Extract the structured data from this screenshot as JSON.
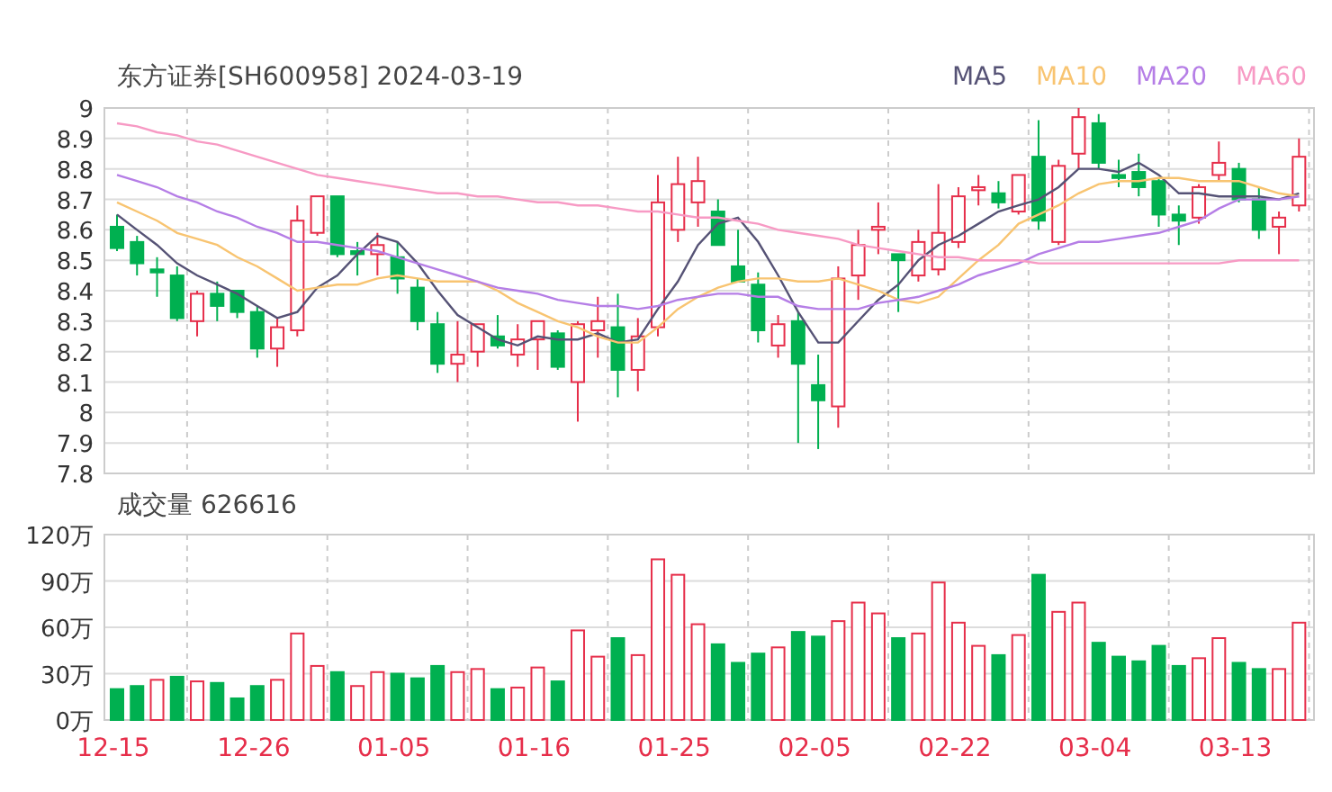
{
  "header": {
    "title": "东方证券[SH600958] 2024-03-19"
  },
  "price_chart": {
    "chart_data": {
      "type": "candlestick",
      "grid": true,
      "ylim": [
        7.8,
        9
      ],
      "yticks": [
        {
          "value": 9,
          "label": "9"
        },
        {
          "value": 8.9,
          "label": "8.9"
        },
        {
          "value": 8.8,
          "label": "8.8"
        },
        {
          "value": 8.7,
          "label": "8.7"
        },
        {
          "value": 8.6,
          "label": "8.6"
        },
        {
          "value": 8.5,
          "label": "8.5"
        },
        {
          "value": 8.4,
          "label": "8.4"
        },
        {
          "value": 8.3,
          "label": "8.3"
        },
        {
          "value": 8.2,
          "label": "8.2"
        },
        {
          "value": 8.1,
          "label": "8.1"
        },
        {
          "value": 8,
          "label": "8"
        },
        {
          "value": 7.9,
          "label": "7.9"
        },
        {
          "value": 7.8,
          "label": "7.8"
        }
      ],
      "ohlc": [
        [
          8.61,
          8.65,
          8.53,
          8.54
        ],
        [
          8.56,
          8.58,
          8.45,
          8.49
        ],
        [
          8.47,
          8.51,
          8.38,
          8.46
        ],
        [
          8.45,
          8.48,
          8.3,
          8.31
        ],
        [
          8.3,
          8.4,
          8.25,
          8.39
        ],
        [
          8.39,
          8.43,
          8.3,
          8.35
        ],
        [
          8.4,
          8.4,
          8.31,
          8.33
        ],
        [
          8.33,
          8.35,
          8.18,
          8.21
        ],
        [
          8.21,
          8.31,
          8.15,
          8.28
        ],
        [
          8.27,
          8.68,
          8.25,
          8.63
        ],
        [
          8.59,
          8.71,
          8.58,
          8.71
        ],
        [
          8.71,
          8.71,
          8.51,
          8.52
        ],
        [
          8.53,
          8.56,
          8.45,
          8.52
        ],
        [
          8.52,
          8.59,
          8.45,
          8.55
        ],
        [
          8.51,
          8.56,
          8.39,
          8.44
        ],
        [
          8.41,
          8.44,
          8.27,
          8.3
        ],
        [
          8.29,
          8.33,
          8.13,
          8.16
        ],
        [
          8.16,
          8.3,
          8.1,
          8.19
        ],
        [
          8.2,
          8.29,
          8.15,
          8.29
        ],
        [
          8.25,
          8.32,
          8.21,
          8.22
        ],
        [
          8.19,
          8.29,
          8.15,
          8.24
        ],
        [
          8.24,
          8.3,
          8.14,
          8.3
        ],
        [
          8.26,
          8.27,
          8.14,
          8.15
        ],
        [
          8.1,
          8.3,
          7.97,
          8.29
        ],
        [
          8.27,
          8.38,
          8.18,
          8.3
        ],
        [
          8.28,
          8.39,
          8.05,
          8.14
        ],
        [
          8.14,
          8.31,
          8.07,
          8.25
        ],
        [
          8.28,
          8.78,
          8.25,
          8.69
        ],
        [
          8.6,
          8.84,
          8.56,
          8.75
        ],
        [
          8.69,
          8.84,
          8.61,
          8.76
        ],
        [
          8.66,
          8.7,
          8.55,
          8.55
        ],
        [
          8.48,
          8.6,
          8.43,
          8.43
        ],
        [
          8.42,
          8.46,
          8.23,
          8.27
        ],
        [
          8.22,
          8.32,
          8.18,
          8.29
        ],
        [
          8.3,
          8.33,
          7.9,
          8.16
        ],
        [
          8.09,
          8.19,
          7.88,
          8.04
        ],
        [
          8.02,
          8.48,
          7.95,
          8.44
        ],
        [
          8.45,
          8.6,
          8.37,
          8.55
        ],
        [
          8.6,
          8.69,
          8.52,
          8.61
        ],
        [
          8.52,
          8.52,
          8.33,
          8.5
        ],
        [
          8.45,
          8.6,
          8.43,
          8.56
        ],
        [
          8.47,
          8.75,
          8.45,
          8.59
        ],
        [
          8.56,
          8.74,
          8.54,
          8.71
        ],
        [
          8.73,
          8.78,
          8.68,
          8.74
        ],
        [
          8.72,
          8.76,
          8.67,
          8.69
        ],
        [
          8.66,
          8.78,
          8.65,
          8.78
        ],
        [
          8.84,
          8.96,
          8.6,
          8.63
        ],
        [
          8.56,
          8.83,
          8.55,
          8.81
        ],
        [
          8.85,
          9.0,
          8.8,
          8.97
        ],
        [
          8.95,
          8.98,
          8.8,
          8.82
        ],
        [
          8.78,
          8.83,
          8.74,
          8.77
        ],
        [
          8.79,
          8.85,
          8.71,
          8.74
        ],
        [
          8.76,
          8.77,
          8.61,
          8.65
        ],
        [
          8.65,
          8.68,
          8.55,
          8.63
        ],
        [
          8.64,
          8.75,
          8.62,
          8.74
        ],
        [
          8.78,
          8.89,
          8.76,
          8.82
        ],
        [
          8.8,
          8.82,
          8.69,
          8.7
        ],
        [
          8.7,
          8.74,
          8.57,
          8.6
        ],
        [
          8.61,
          8.66,
          8.52,
          8.64
        ],
        [
          8.68,
          8.9,
          8.66,
          8.84
        ]
      ],
      "series": [
        {
          "name": "MA5",
          "type": "line",
          "color": "#555275",
          "values": [
            8.65,
            8.6,
            8.55,
            8.49,
            8.45,
            8.42,
            8.39,
            8.35,
            8.31,
            8.33,
            8.41,
            8.45,
            8.52,
            8.58,
            8.56,
            8.49,
            8.4,
            8.32,
            8.28,
            8.24,
            8.22,
            8.25,
            8.24,
            8.24,
            8.26,
            8.23,
            8.24,
            8.34,
            8.43,
            8.55,
            8.62,
            8.64,
            8.56,
            8.45,
            8.33,
            8.23,
            8.23,
            8.3,
            8.37,
            8.42,
            8.5,
            8.55,
            8.58,
            8.62,
            8.66,
            8.68,
            8.7,
            8.74,
            8.8,
            8.8,
            8.79,
            8.82,
            8.78,
            8.72,
            8.72,
            8.71,
            8.71,
            8.71,
            8.7,
            8.72
          ]
        },
        {
          "name": "MA10",
          "type": "line",
          "color": "#f8c471",
          "values": [
            8.69,
            8.66,
            8.63,
            8.59,
            8.57,
            8.55,
            8.51,
            8.48,
            8.44,
            8.4,
            8.41,
            8.42,
            8.42,
            8.44,
            8.45,
            8.44,
            8.43,
            8.43,
            8.43,
            8.4,
            8.36,
            8.33,
            8.3,
            8.28,
            8.25,
            8.23,
            8.23,
            8.28,
            8.34,
            8.38,
            8.41,
            8.43,
            8.44,
            8.44,
            8.43,
            8.43,
            8.44,
            8.42,
            8.4,
            8.37,
            8.36,
            8.38,
            8.44,
            8.5,
            8.55,
            8.62,
            8.65,
            8.68,
            8.72,
            8.75,
            8.76,
            8.76,
            8.77,
            8.77,
            8.76,
            8.76,
            8.76,
            8.74,
            8.72,
            8.71
          ]
        },
        {
          "name": "MA20",
          "type": "line",
          "color": "#b57ee6",
          "values": [
            8.78,
            8.76,
            8.74,
            8.71,
            8.69,
            8.66,
            8.64,
            8.61,
            8.59,
            8.56,
            8.56,
            8.55,
            8.54,
            8.53,
            8.51,
            8.49,
            8.47,
            8.45,
            8.43,
            8.41,
            8.4,
            8.39,
            8.37,
            8.36,
            8.35,
            8.35,
            8.34,
            8.35,
            8.37,
            8.38,
            8.39,
            8.39,
            8.38,
            8.38,
            8.35,
            8.34,
            8.34,
            8.34,
            8.36,
            8.37,
            8.38,
            8.4,
            8.42,
            8.45,
            8.47,
            8.49,
            8.52,
            8.54,
            8.56,
            8.56,
            8.57,
            8.58,
            8.59,
            8.61,
            8.63,
            8.67,
            8.7,
            8.7,
            8.7,
            8.71
          ]
        },
        {
          "name": "MA60",
          "type": "line",
          "color": "#f79ac4",
          "values": [
            8.95,
            8.94,
            8.92,
            8.91,
            8.89,
            8.88,
            8.86,
            8.84,
            8.82,
            8.8,
            8.78,
            8.77,
            8.76,
            8.75,
            8.74,
            8.73,
            8.72,
            8.72,
            8.71,
            8.71,
            8.7,
            8.69,
            8.69,
            8.68,
            8.68,
            8.67,
            8.66,
            8.66,
            8.65,
            8.64,
            8.64,
            8.63,
            8.62,
            8.6,
            8.59,
            8.58,
            8.57,
            8.55,
            8.54,
            8.53,
            8.52,
            8.51,
            8.51,
            8.5,
            8.5,
            8.5,
            8.49,
            8.49,
            8.49,
            8.49,
            8.49,
            8.49,
            8.49,
            8.49,
            8.49,
            8.49,
            8.5,
            8.5,
            8.5,
            8.5
          ]
        }
      ]
    }
  },
  "volume_chart": {
    "title": "成交量 626616",
    "chart_data": {
      "type": "bar",
      "grid": true,
      "ylim": [
        0,
        120
      ],
      "categories": [
        "12-15",
        null,
        null,
        null,
        null,
        null,
        null,
        "12-26",
        null,
        null,
        null,
        null,
        null,
        null,
        "01-05",
        null,
        null,
        null,
        null,
        null,
        null,
        "01-16",
        null,
        null,
        null,
        null,
        null,
        null,
        "01-25",
        null,
        null,
        null,
        null,
        null,
        null,
        "02-05",
        null,
        null,
        null,
        null,
        null,
        null,
        "02-22",
        null,
        null,
        null,
        null,
        null,
        null,
        "03-04",
        null,
        null,
        null,
        null,
        null,
        null,
        "03-13",
        null,
        null,
        null
      ],
      "yticks": [
        {
          "value": 120,
          "label": "120万"
        },
        {
          "value": 90,
          "label": "90万"
        },
        {
          "value": 60,
          "label": "60万"
        },
        {
          "value": 30,
          "label": "30万"
        },
        {
          "value": 0,
          "label": "0万"
        }
      ],
      "series": [
        {
          "color": "#e62e4a",
          "values": [
            null,
            null,
            26,
            null,
            25,
            null,
            null,
            null,
            26,
            56,
            35,
            null,
            22,
            31,
            null,
            null,
            null,
            31,
            33,
            null,
            21,
            34,
            null,
            58,
            41,
            null,
            42,
            104,
            94,
            62,
            null,
            null,
            null,
            47,
            null,
            null,
            64,
            76,
            69,
            null,
            56,
            89,
            63,
            48,
            null,
            55,
            null,
            70,
            76,
            null,
            null,
            null,
            null,
            null,
            40,
            53,
            null,
            null,
            33,
            63
          ]
        },
        {
          "color": "#00b050",
          "values": [
            20,
            22,
            null,
            28,
            null,
            24,
            14,
            22,
            null,
            null,
            null,
            31,
            null,
            null,
            30,
            27,
            35,
            null,
            null,
            20,
            null,
            null,
            25,
            null,
            null,
            53,
            null,
            null,
            null,
            null,
            49,
            37,
            43,
            null,
            57,
            54,
            null,
            null,
            null,
            53,
            null,
            null,
            null,
            null,
            42,
            null,
            94,
            null,
            null,
            50,
            41,
            38,
            48,
            35,
            null,
            null,
            37,
            33,
            null,
            null
          ]
        }
      ]
    }
  }
}
